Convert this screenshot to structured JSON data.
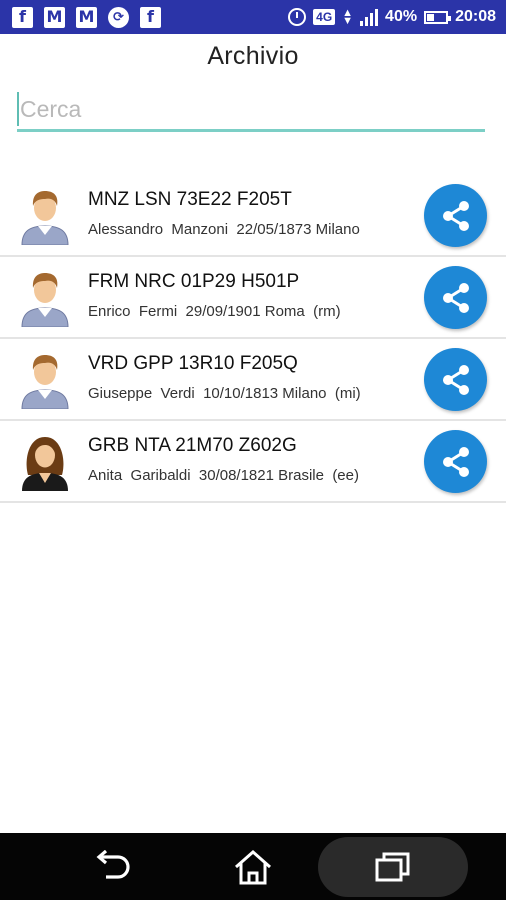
{
  "status_bar": {
    "icons_left": [
      "facebook-icon",
      "gmail-icon",
      "gmail-icon",
      "sync-icon",
      "facebook-icon"
    ],
    "network": "4G",
    "battery": "40%",
    "battery_level": 0.4,
    "time": "20:08",
    "color": "#2b34a8"
  },
  "header": {
    "title": "Archivio"
  },
  "search": {
    "placeholder": "Cerca",
    "value": ""
  },
  "records": [
    {
      "code": "MNZ LSN 73E22 F205T",
      "details": "Alessandro  Manzoni  22/05/1873 Milano",
      "avatar": "male"
    },
    {
      "code": "FRM NRC 01P29 H501P",
      "details": "Enrico  Fermi  29/09/1901 Roma  (rm)",
      "avatar": "male"
    },
    {
      "code": "VRD GPP 13R10 F205Q",
      "details": "Giuseppe  Verdi  10/10/1813 Milano  (mi)",
      "avatar": "male"
    },
    {
      "code": "GRB NTA 21M70 Z602G",
      "details": "Anita  Garibaldi  30/08/1821 Brasile  (ee)",
      "avatar": "female"
    }
  ],
  "colors": {
    "accent": "#1e88d6",
    "search_underline": "#7ccfc6",
    "navbar": "#050505"
  },
  "nav": [
    "back-icon",
    "home-icon",
    "recent-apps-icon"
  ]
}
